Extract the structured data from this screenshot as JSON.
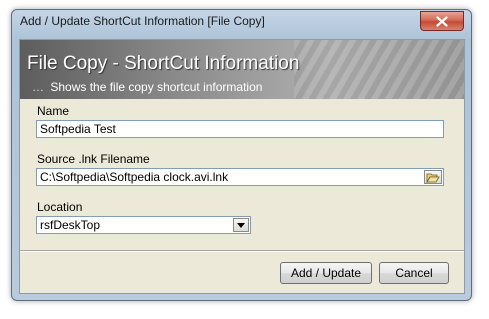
{
  "window": {
    "title": "Add / Update ShortCut Information [File Copy]",
    "close_icon": "close-icon"
  },
  "banner": {
    "title": "File Copy - ShortCut Information",
    "subtitle": "Shows the file copy shortcut information",
    "subtitle_prefix": "…"
  },
  "form": {
    "name_label": "Name",
    "name_value": "Softpedia Test",
    "source_label": "Source .lnk Filename",
    "source_value": "C:\\Softpedia\\Softpedia clock.avi.lnk",
    "browse_icon": "folder-open-icon",
    "location_label": "Location",
    "location_value": "rsfDeskTop"
  },
  "buttons": {
    "add_update": "Add / Update",
    "cancel": "Cancel"
  },
  "colors": {
    "banner_text": "#ffffff",
    "client_bg": "#ece9d8",
    "close_red": "#c44a35"
  }
}
